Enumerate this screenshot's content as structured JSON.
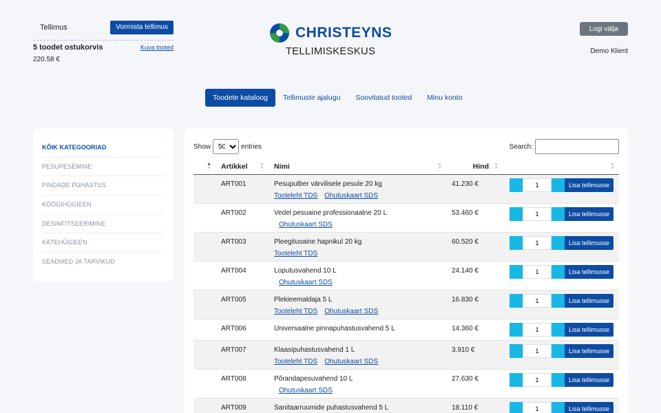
{
  "header": {
    "order_label": "Tellimus",
    "order_button": "Vormista tellimus",
    "cart_count": "5 toodet ostukorvis",
    "cart_link": "Kuva tooted",
    "cart_total": "220.58 €",
    "brand_name": "CHRISTEYNS",
    "subtitle": "TELLIMISKESKUS",
    "logout_button": "Logi välja",
    "user_name": "Demo Klient"
  },
  "colors": {
    "primary": "#0d4ca3",
    "accent": "#17b8e6",
    "logo_green": "#2ea043"
  },
  "nav": {
    "tabs": [
      {
        "label": "Toodete kataloog",
        "active": true
      },
      {
        "label": "Tellimuste ajalugu",
        "active": false
      },
      {
        "label": "Soovitatud tooted",
        "active": false
      },
      {
        "label": "Minu konto",
        "active": false
      }
    ]
  },
  "sidebar": {
    "categories": [
      {
        "label": "KÕIK KATEGOORIAD",
        "active": true
      },
      {
        "label": "PESUPESEMINE"
      },
      {
        "label": "PINDADE PUHASTUS"
      },
      {
        "label": "KÖÖGIHÜGIEEN"
      },
      {
        "label": "DESINFITSEERIMINE"
      },
      {
        "label": "KÄTEHÜGIEEN"
      },
      {
        "label": "SEADMED JA TARVIKUD"
      }
    ]
  },
  "table": {
    "show_label": "Show",
    "entries_label": "entries",
    "page_size": "50",
    "search_label": "Search:",
    "columns": {
      "article": "Artikkel",
      "name": "Nimi",
      "price": "Hind"
    },
    "add_label": "Lisa tellimusse",
    "rows": [
      {
        "article": "ART001",
        "name": "Pesupulber värvilisele pesule 20 kg",
        "price": "41.230 €",
        "tds": "Tooteleht TDS",
        "sds": "Ohutuskaart SDS",
        "qty": "1"
      },
      {
        "article": "ART002",
        "name": "Vedel pesuaine professionaalne 20 L",
        "price": "53.460 €",
        "tds": "",
        "sds": "Ohutuskaart SDS",
        "qty": "1"
      },
      {
        "article": "ART003",
        "name": "Pleegitusaine hapnikul 20 kg",
        "price": "60.520 €",
        "tds": "Tooteleht TDS",
        "sds": "",
        "qty": "1"
      },
      {
        "article": "ART004",
        "name": "Loputusvahend 10 L",
        "price": "24.140 €",
        "tds": "",
        "sds": "Ohutuskaart SDS",
        "qty": "1"
      },
      {
        "article": "ART005",
        "name": "Plekieemaldaja 5 L",
        "price": "16.830 €",
        "tds": "Tooteleht TDS",
        "sds": "Ohutuskaart SDS",
        "qty": "1"
      },
      {
        "article": "ART006",
        "name": "Universaalne pinnapuhastusvahend 5 L",
        "price": "14.360 €",
        "tds": "",
        "sds": "",
        "qty": "1"
      },
      {
        "article": "ART007",
        "name": "Klaasipuhastusvahend 1 L",
        "price": "3.910 €",
        "tds": "Tooteleht TDS",
        "sds": "Ohutuskaart SDS",
        "qty": "1"
      },
      {
        "article": "ART008",
        "name": "Põrandapesuvahend 10 L",
        "price": "27.630 €",
        "tds": "",
        "sds": "Ohutuskaart SDS",
        "qty": "1"
      },
      {
        "article": "ART009",
        "name": "Sanitaarruumide puhastusvahend 5 L",
        "price": "18.110 €",
        "tds": "",
        "sds": "",
        "qty": "1"
      }
    ]
  }
}
